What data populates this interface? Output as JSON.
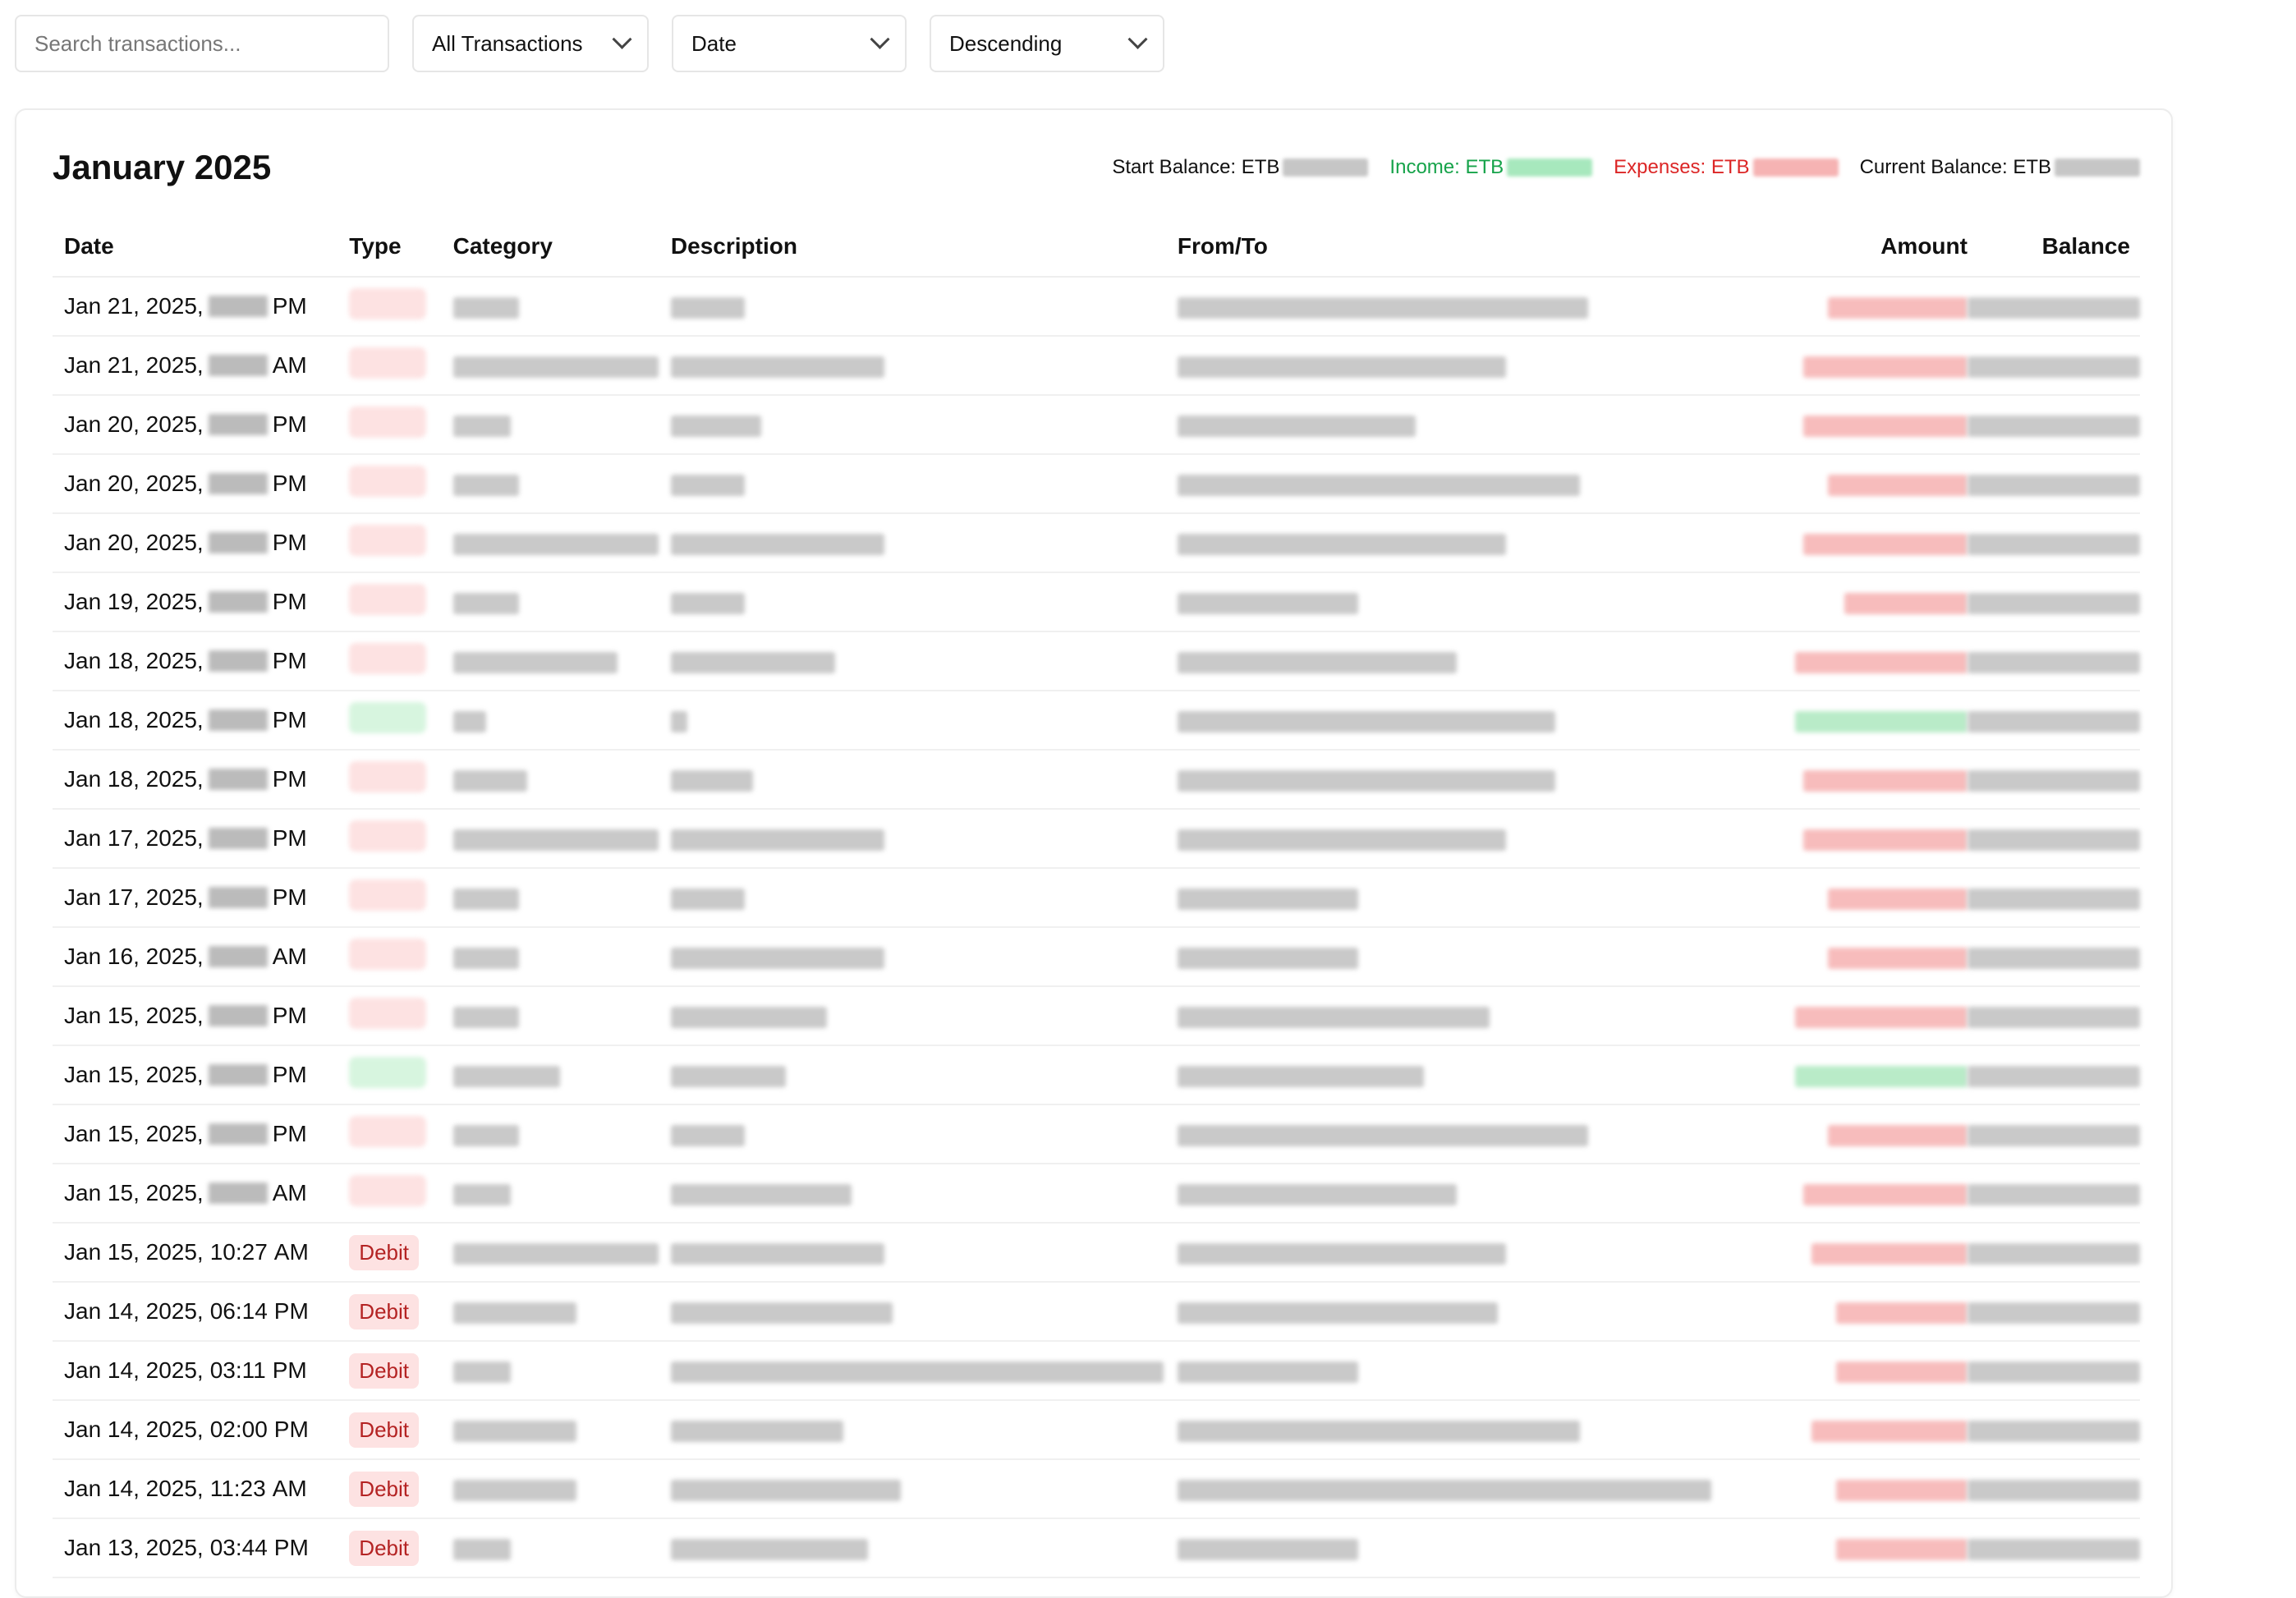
{
  "toolbar": {
    "search_placeholder": "Search transactions...",
    "type_filter": "All Transactions",
    "sort_field": "Date",
    "sort_order": "Descending"
  },
  "period": {
    "title": "January 2025",
    "start_balance_label": "Start Balance: ETB",
    "income_label": "Income: ETB",
    "expenses_label": "Expenses: ETB",
    "current_balance_label": "Current Balance: ETB"
  },
  "table": {
    "columns": [
      "Date",
      "Type",
      "Category",
      "Description",
      "From/To",
      "Amount",
      "Balance"
    ],
    "rows": [
      {
        "date_prefix": "Jan 21, 2025,",
        "time": "",
        "ampm": "PM",
        "type": "",
        "kind": "debit"
      },
      {
        "date_prefix": "Jan 21, 2025,",
        "time": "",
        "ampm": "AM",
        "type": "",
        "kind": "debit"
      },
      {
        "date_prefix": "Jan 20, 2025,",
        "time": "",
        "ampm": "PM",
        "type": "",
        "kind": "debit"
      },
      {
        "date_prefix": "Jan 20, 2025,",
        "time": "",
        "ampm": "PM",
        "type": "",
        "kind": "debit"
      },
      {
        "date_prefix": "Jan 20, 2025,",
        "time": "",
        "ampm": "PM",
        "type": "",
        "kind": "debit"
      },
      {
        "date_prefix": "Jan 19, 2025,",
        "time": "",
        "ampm": "PM",
        "type": "",
        "kind": "debit"
      },
      {
        "date_prefix": "Jan 18, 2025,",
        "time": "",
        "ampm": "PM",
        "type": "",
        "kind": "debit"
      },
      {
        "date_prefix": "Jan 18, 2025,",
        "time": "",
        "ampm": "PM",
        "type": "",
        "kind": "credit"
      },
      {
        "date_prefix": "Jan 18, 2025,",
        "time": "",
        "ampm": "PM",
        "type": "",
        "kind": "debit"
      },
      {
        "date_prefix": "Jan 17, 2025,",
        "time": "",
        "ampm": "PM",
        "type": "",
        "kind": "debit"
      },
      {
        "date_prefix": "Jan 17, 2025,",
        "time": "",
        "ampm": "PM",
        "type": "",
        "kind": "debit"
      },
      {
        "date_prefix": "Jan 16, 2025,",
        "time": "",
        "ampm": "AM",
        "type": "",
        "kind": "debit"
      },
      {
        "date_prefix": "Jan 15, 2025,",
        "time": "",
        "ampm": "PM",
        "type": "",
        "kind": "debit"
      },
      {
        "date_prefix": "Jan 15, 2025,",
        "time": "",
        "ampm": "PM",
        "type": "",
        "kind": "credit"
      },
      {
        "date_prefix": "Jan 15, 2025,",
        "time": "",
        "ampm": "PM",
        "type": "",
        "kind": "debit"
      },
      {
        "date_prefix": "Jan 15, 2025,",
        "time": "",
        "ampm": "AM",
        "type": "",
        "kind": "debit"
      },
      {
        "date_prefix": "Jan 15, 2025,",
        "time": "10:27",
        "ampm": "AM",
        "type": "Debit",
        "kind": "debit"
      },
      {
        "date_prefix": "Jan 14, 2025,",
        "time": "06:14",
        "ampm": "PM",
        "type": "Debit",
        "kind": "debit"
      },
      {
        "date_prefix": "Jan 14, 2025,",
        "time": "03:11",
        "ampm": "PM",
        "type": "Debit",
        "kind": "debit"
      },
      {
        "date_prefix": "Jan 14, 2025,",
        "time": "02:00",
        "ampm": "PM",
        "type": "Debit",
        "kind": "debit"
      },
      {
        "date_prefix": "Jan 14, 2025,",
        "time": "11:23",
        "ampm": "AM",
        "type": "Debit",
        "kind": "debit"
      },
      {
        "date_prefix": "Jan 13, 2025,",
        "time": "03:44",
        "ampm": "PM",
        "type": "Debit",
        "kind": "debit"
      }
    ]
  }
}
